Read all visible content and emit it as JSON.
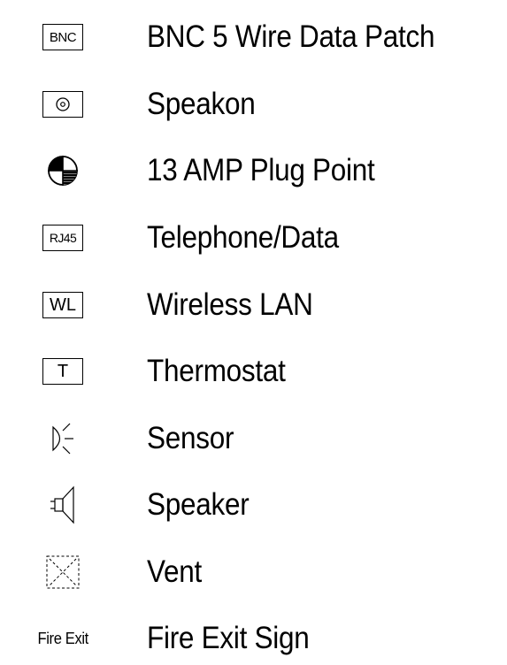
{
  "legend": {
    "items": [
      {
        "symbol_text": "BNC",
        "icon": "bnc-box-icon",
        "label": "BNC 5 Wire Data Patch"
      },
      {
        "symbol_text": "",
        "icon": "speakon-icon",
        "label": "Speakon"
      },
      {
        "symbol_text": "",
        "icon": "plug-point-icon",
        "label": "13 AMP Plug Point"
      },
      {
        "symbol_text": "RJ45",
        "icon": "rj45-box-icon",
        "label": "Telephone/Data"
      },
      {
        "symbol_text": "WL",
        "icon": "wireless-lan-box-icon",
        "label": "Wireless LAN"
      },
      {
        "symbol_text": "T",
        "icon": "thermostat-box-icon",
        "label": "Thermostat"
      },
      {
        "symbol_text": "",
        "icon": "sensor-icon",
        "label": "Sensor"
      },
      {
        "symbol_text": "",
        "icon": "speaker-icon",
        "label": "Speaker"
      },
      {
        "symbol_text": "",
        "icon": "vent-icon",
        "label": "Vent"
      },
      {
        "symbol_text": "Fire Exit",
        "icon": "fire-exit-text-icon",
        "label": "Fire Exit Sign"
      }
    ]
  }
}
